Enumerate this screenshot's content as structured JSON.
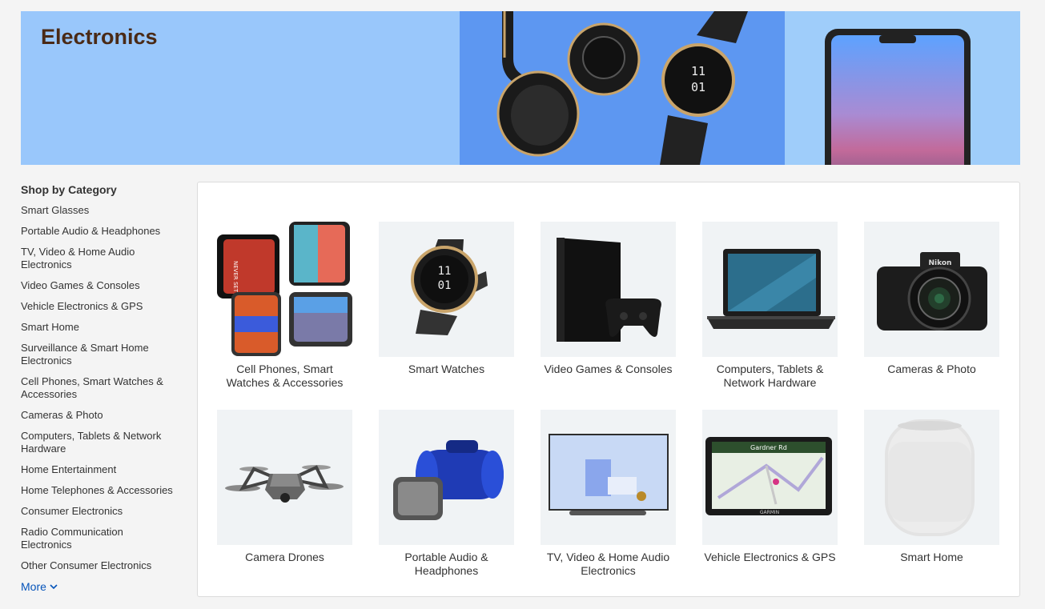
{
  "hero": {
    "title": "Electronics"
  },
  "watch_face": {
    "hour": "11",
    "minute": "01"
  },
  "sidebar": {
    "heading": "Shop by Category",
    "items": [
      "Smart Glasses",
      "Portable Audio & Headphones",
      "TV, Video & Home Audio Electronics",
      "Video Games & Consoles",
      "Vehicle Electronics & GPS",
      "Smart Home",
      "Surveillance & Smart Home Electronics",
      "Cell Phones, Smart Watches & Accessories",
      "Cameras & Photo",
      "Computers, Tablets & Network Hardware",
      "Home Entertainment",
      "Home Telephones & Accessories",
      "Consumer Electronics",
      "Radio Communication Electronics",
      "Other Consumer Electronics"
    ],
    "more_label": "More"
  },
  "tiles": [
    {
      "label": "Cell Phones, Smart Watches & Accessories",
      "icon": "cell-phones-image",
      "phone_text": "NEVER SETTLE"
    },
    {
      "label": "Smart Watches",
      "icon": "smart-watch-image"
    },
    {
      "label": "Video Games & Consoles",
      "icon": "game-console-image"
    },
    {
      "label": "Computers, Tablets & Network Hardware",
      "icon": "laptop-image"
    },
    {
      "label": "Cameras & Photo",
      "icon": "camera-image",
      "brand_text": "Nikon"
    },
    {
      "label": "Camera Drones",
      "icon": "drone-image"
    },
    {
      "label": "Portable Audio & Headphones",
      "icon": "speaker-image"
    },
    {
      "label": "TV, Video & Home Audio Electronics",
      "icon": "tv-image"
    },
    {
      "label": "Vehicle Electronics & GPS",
      "icon": "gps-image",
      "brand_text": "GARMIN",
      "street_text": "Gardner Rd"
    },
    {
      "label": "Smart Home",
      "icon": "smart-speaker-image"
    }
  ],
  "colors": {
    "hero_left": "#99c7fb",
    "hero_mid": "#5d97f1",
    "hero_right": "#9fcdfa",
    "title_text": "#4a2a16",
    "link": "#0654ba",
    "tile_bg": "#f0f3f5"
  }
}
